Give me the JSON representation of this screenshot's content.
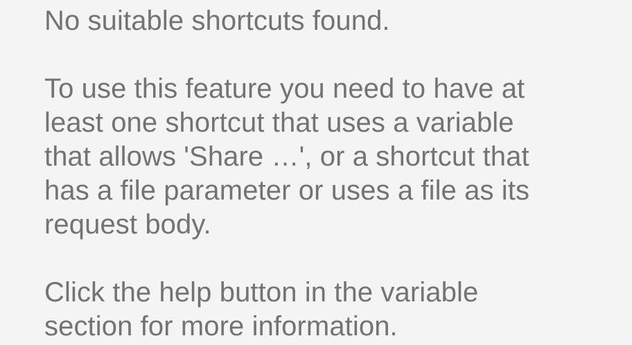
{
  "dialog": {
    "title_line": "No suitable shortcuts found.",
    "explanation_lines": [
      "To use this feature you need to have at",
      "least one shortcut that uses a variable",
      "that allows 'Share …', or a shortcut that",
      "has a file parameter or uses a file as its",
      "request body."
    ],
    "help_lines": [
      "Click the help button in the variable",
      "section for more information."
    ]
  }
}
